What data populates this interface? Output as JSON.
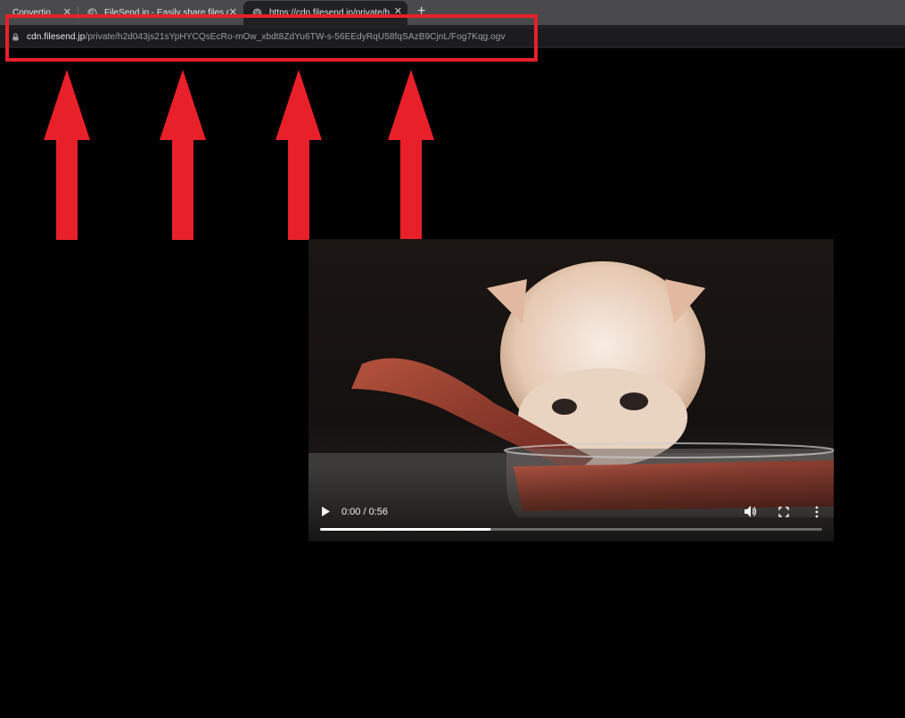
{
  "tabs": [
    {
      "title": "Convertio",
      "active": false
    },
    {
      "title": "FileSend.jp - Easily share files or...",
      "active": false
    },
    {
      "title": "https://cdn.filesend.jp/private/h...",
      "active": true
    }
  ],
  "new_tab_label": "+",
  "address_bar": {
    "host": "cdn.filesend.jp",
    "path": "/private/h2d043js21sYpHYCQsEcRo-mOw_xbdt8ZdYu6TW-s-56EEdyRqU58fqSAzB9CjnL/Fog7Kqg.ogv"
  },
  "annotation": {
    "color": "#e8202a",
    "arrow_count": 4
  },
  "video": {
    "time_display": "0:00 / 0:56",
    "progress": 0.34,
    "subject": "kitten eating raw meat from glass bowl"
  },
  "icons": {
    "play": "play-icon",
    "volume": "volume-icon",
    "fullscreen": "fullscreen-icon",
    "more": "more-options-icon",
    "lock": "lock-icon",
    "close": "close-icon"
  }
}
